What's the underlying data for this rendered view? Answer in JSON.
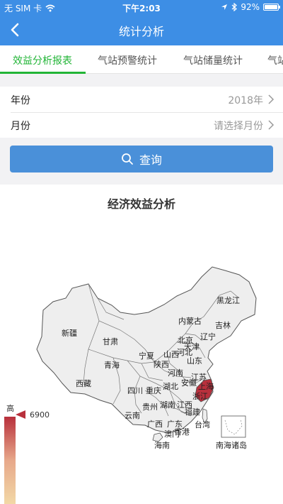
{
  "status_bar": {
    "carrier": "无 SIM 卡",
    "time": "下午2:03",
    "battery": "92%"
  },
  "nav": {
    "title": "统计分析"
  },
  "tabs": [
    {
      "label": "效益分析报表",
      "active": true
    },
    {
      "label": "气站预警统计",
      "active": false
    },
    {
      "label": "气站储量统计",
      "active": false
    },
    {
      "label": "气站",
      "active": false
    }
  ],
  "form": {
    "year": {
      "label": "年份",
      "value": "2018年"
    },
    "month": {
      "label": "月份",
      "placeholder": "请选择月份"
    }
  },
  "query_button": {
    "label": "查询"
  },
  "chart": {
    "title": "经济效益分析",
    "legend": {
      "high_label": "高",
      "max_value": "6900"
    },
    "colors": {
      "region_fill": "#eeeeee",
      "highlight": "#b8303c"
    },
    "highlighted_region": "浙江",
    "labels": [
      "黑龙江",
      "吉林",
      "内蒙古",
      "辽宁",
      "北京",
      "天津",
      "河北",
      "新疆",
      "甘肃",
      "宁夏",
      "山西",
      "山东",
      "青海",
      "陕西",
      "河南",
      "江苏",
      "西藏",
      "湖北",
      "安徽",
      "上海",
      "四川",
      "重庆",
      "浙江",
      "贵州",
      "湖南",
      "江西",
      "云南",
      "福建",
      "广西",
      "广东",
      "台湾",
      "澳门",
      "香港",
      "海南",
      "南海诸岛"
    ]
  }
}
